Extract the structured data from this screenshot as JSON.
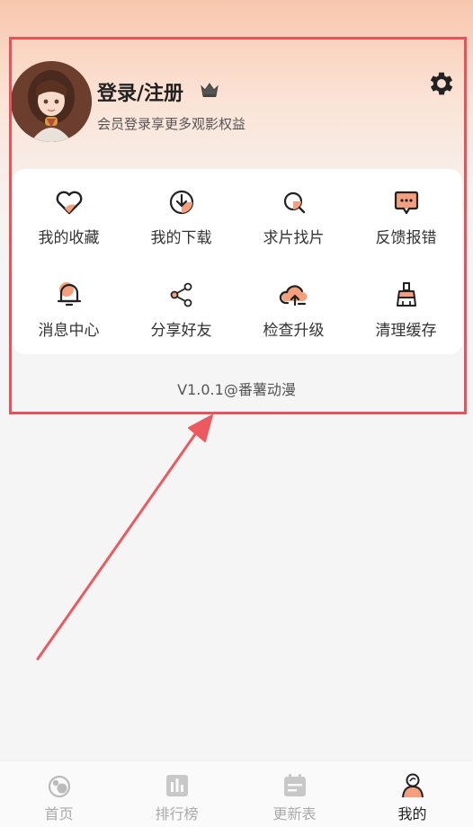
{
  "header": {
    "login_title": "登录/注册",
    "subtitle": "会员登录享更多观影权益"
  },
  "grid": {
    "items": [
      {
        "label": "我的收藏",
        "icon": "heart-icon"
      },
      {
        "label": "我的下载",
        "icon": "download-icon"
      },
      {
        "label": "求片找片",
        "icon": "search-icon"
      },
      {
        "label": "反馈报错",
        "icon": "feedback-icon"
      },
      {
        "label": "消息中心",
        "icon": "bell-icon"
      },
      {
        "label": "分享好友",
        "icon": "share-icon"
      },
      {
        "label": "检查升级",
        "icon": "upload-cloud-icon"
      },
      {
        "label": "清理缓存",
        "icon": "broom-icon"
      }
    ]
  },
  "version": "V1.0.1@番薯动漫",
  "tabs": [
    {
      "label": "首页",
      "icon": "home-icon",
      "active": false
    },
    {
      "label": "排行榜",
      "icon": "ranking-icon",
      "active": false
    },
    {
      "label": "更新表",
      "icon": "calendar-icon",
      "active": false
    },
    {
      "label": "我的",
      "icon": "profile-icon",
      "active": true
    }
  ],
  "colors": {
    "accent": "#f4a07e",
    "highlight_box": "#e8525a",
    "text_primary": "#222222",
    "text_secondary": "#555555",
    "tab_inactive": "#aaaaaa"
  }
}
